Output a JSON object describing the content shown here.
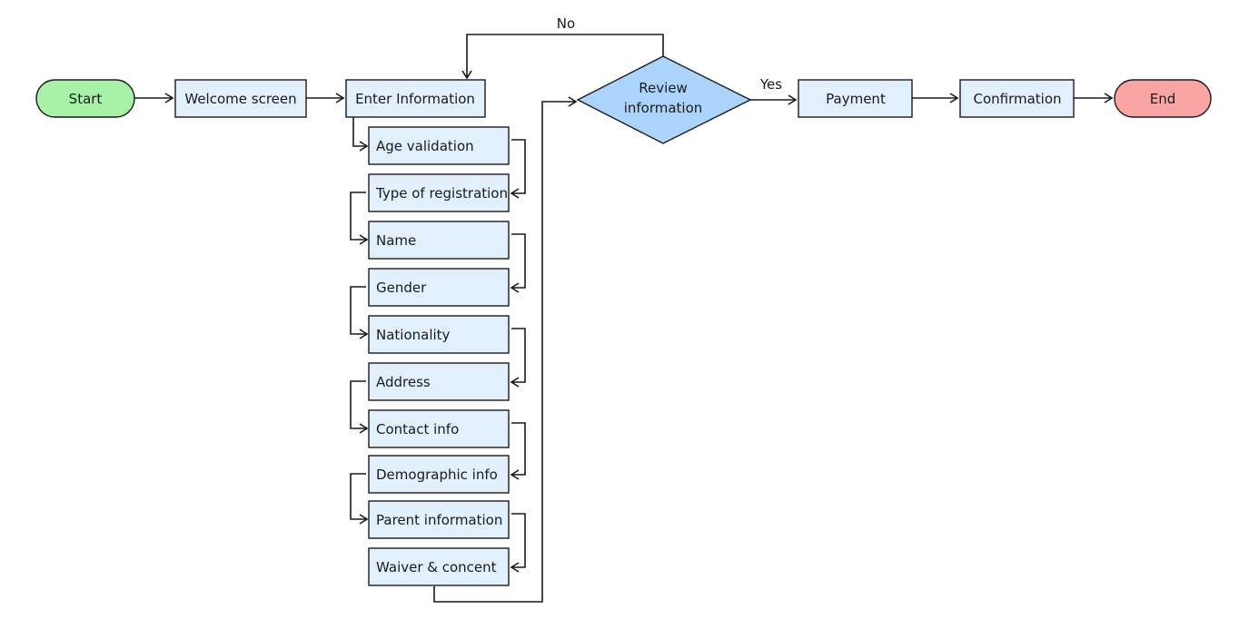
{
  "colors": {
    "start_fill": "#a7f2a7",
    "end_fill": "#f9a5a5",
    "process_fill": "#e2f0fd",
    "decision_fill": "#acd3fb",
    "stroke": "#1a1a1a"
  },
  "nodes": {
    "start": {
      "label": "Start"
    },
    "welcome": {
      "label": "Welcome screen"
    },
    "enter_info": {
      "label": "Enter Information"
    },
    "review": {
      "label_line1": "Review",
      "label_line2": "information"
    },
    "payment": {
      "label": "Payment"
    },
    "confirmation": {
      "label": "Confirmation"
    },
    "end": {
      "label": "End"
    }
  },
  "steps": [
    {
      "label": "Age validation"
    },
    {
      "label": "Type of registration"
    },
    {
      "label": "Name"
    },
    {
      "label": "Gender"
    },
    {
      "label": "Nationality"
    },
    {
      "label": "Address"
    },
    {
      "label": "Contact info"
    },
    {
      "label": "Demographic info"
    },
    {
      "label": "Parent information"
    },
    {
      "label": "Waiver & concent"
    }
  ],
  "edge_labels": {
    "no": "No",
    "yes": "Yes"
  }
}
